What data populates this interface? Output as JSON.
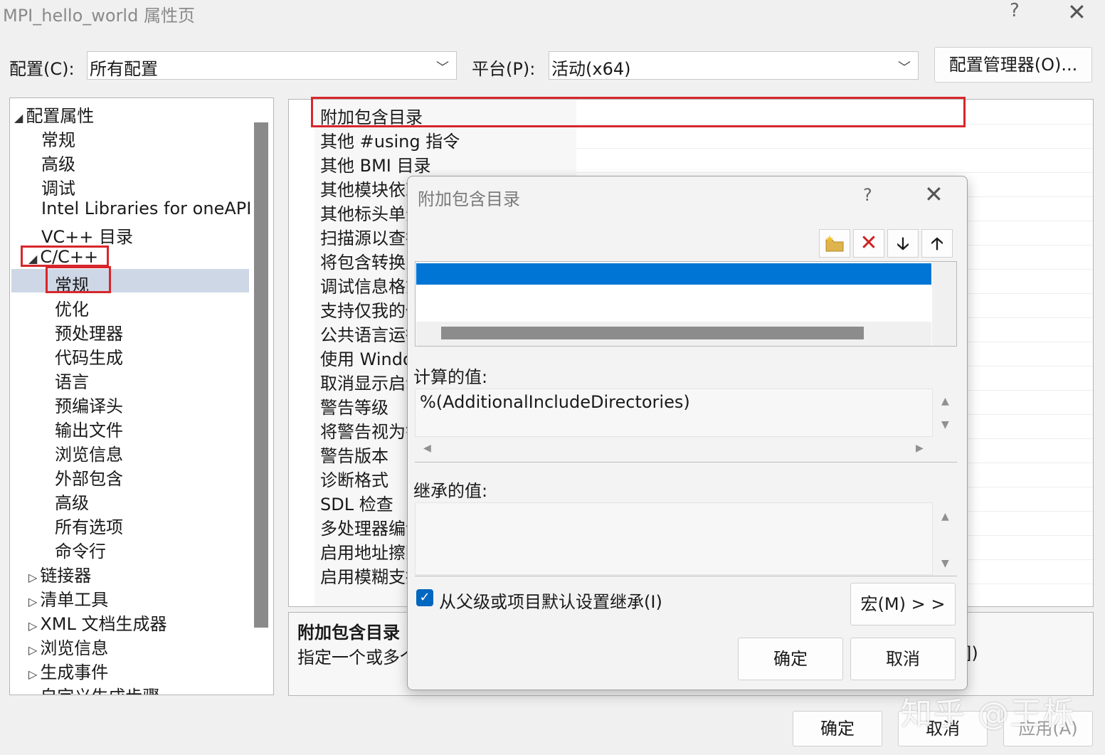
{
  "window": {
    "title": "MPI_hello_world 属性页",
    "help": "?",
    "close": "✕"
  },
  "config": {
    "config_label": "配置(C):",
    "config_value": "所有配置",
    "platform_label": "平台(P):",
    "platform_value": "活动(x64)",
    "manager_button": "配置管理器(O)...",
    "arrow": "﹀"
  },
  "tree": {
    "root": "配置属性",
    "items": [
      "常规",
      "高级",
      "调试",
      "Intel Libraries for oneAPI",
      "VC++ 目录"
    ],
    "cpp": "C/C++",
    "cpp_children": [
      "常规",
      "优化",
      "预处理器",
      "代码生成",
      "语言",
      "预编译头",
      "输出文件",
      "浏览信息",
      "外部包含",
      "高级",
      "所有选项",
      "命令行"
    ],
    "collapsed": [
      "链接器",
      "清单工具",
      "XML 文档生成器",
      "浏览信息",
      "生成事件",
      "自定义生成步骤"
    ]
  },
  "properties": [
    "附加包含目录",
    "其他 #using 指令",
    "其他 BMI 目录",
    "其他模块依赖",
    "其他标头单元",
    "扫描源以查找",
    "将包含转换为",
    "调试信息格式",
    "支持仅我的代码",
    "公共语言运行",
    "使用 Windo",
    "取消显示启动",
    "警告等级",
    "将警告视为错",
    "警告版本",
    "诊断格式",
    "SDL 检查",
    "多处理器编译",
    "启用地址擦除",
    "启用模糊支持"
  ],
  "description": {
    "title": "附加包含目录",
    "text": "指定一个或多个",
    "tail": "])"
  },
  "dialog": {
    "title": "附加包含目录",
    "help": "?",
    "close": "✕",
    "computed_label": "计算的值:",
    "computed_value": "%(AdditionalIncludeDirectories)",
    "inherited_label": "继承的值:",
    "inherit_checkbox": "从父级或项目默认设置继承(I)",
    "macro_button": "宏(M) > >",
    "ok_button": "确定",
    "cancel_button": "取消"
  },
  "bottom": {
    "ok_button": "确定",
    "cancel_button": "取消",
    "apply_button": "应用(A)"
  },
  "watermark": "知乎 @王栎"
}
